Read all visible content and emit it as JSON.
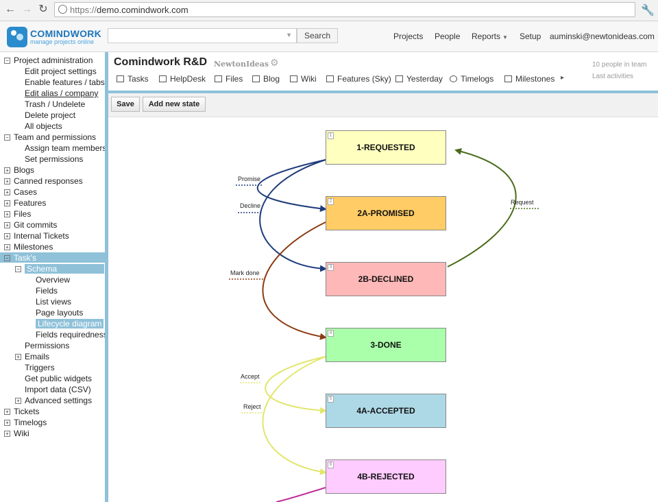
{
  "browser": {
    "url_prefix": "https://",
    "url_host": "demo.comindwork.com",
    "back_icon": "arrow-left-icon",
    "forward_icon": "arrow-right-icon",
    "reload_icon": "reload-icon",
    "wrench_icon": "wrench-icon"
  },
  "header": {
    "logo_name": "COMINDWORK",
    "logo_tagline": "manage projects online",
    "search_button": "Search",
    "nav": {
      "projects": "Projects",
      "people": "People",
      "reports": "Reports",
      "setup": "Setup",
      "user": "auminski@newtonideas.com"
    }
  },
  "sidebar": {
    "items": [
      {
        "label": "Project administration",
        "expander": "⊟"
      },
      {
        "label": "Edit project settings"
      },
      {
        "label": "Enable features / tabs"
      },
      {
        "label": "Edit alias / company"
      },
      {
        "label": "Trash / Undelete"
      },
      {
        "label": "Delete project"
      },
      {
        "label": "All objects"
      },
      {
        "label": "Team and permissions",
        "expander": "⊟"
      },
      {
        "label": "Assign team members"
      },
      {
        "label": "Set permissions"
      },
      {
        "label": "Blogs",
        "expander": "⊞"
      },
      {
        "label": "Canned responses",
        "expander": "⊞"
      },
      {
        "label": "Cases",
        "expander": "⊞"
      },
      {
        "label": "Features",
        "expander": "⊞"
      },
      {
        "label": "Files",
        "expander": "⊞"
      },
      {
        "label": "Git commits",
        "expander": "⊞"
      },
      {
        "label": "Internal Tickets",
        "expander": "⊞"
      },
      {
        "label": "Milestones",
        "expander": "⊞"
      },
      {
        "label": "Task's",
        "expander": "⊟"
      },
      {
        "label": "Schema",
        "expander": "⊟"
      },
      {
        "label": "Overview"
      },
      {
        "label": "Fields"
      },
      {
        "label": "List views"
      },
      {
        "label": "Page layouts"
      },
      {
        "label": "Lifecycle diagram"
      },
      {
        "label": "Fields requiredness"
      },
      {
        "label": "Permissions"
      },
      {
        "label": "Emails",
        "expander": "⊞"
      },
      {
        "label": "Triggers"
      },
      {
        "label": "Get public widgets"
      },
      {
        "label": "Import data (CSV)"
      },
      {
        "label": "Advanced settings",
        "expander": "⊞"
      },
      {
        "label": "Tickets",
        "expander": "⊞"
      },
      {
        "label": "Timelogs",
        "expander": "⊞"
      },
      {
        "label": "Wiki",
        "expander": "⊞"
      }
    ]
  },
  "project": {
    "title": "Comindwork R&D",
    "org": "NewtonIdeas",
    "people_info": "10 people in team",
    "last_activities": "Last activities"
  },
  "tabs": [
    {
      "label": "Tasks"
    },
    {
      "label": "HelpDesk"
    },
    {
      "label": "Files"
    },
    {
      "label": "Blog"
    },
    {
      "label": "Wiki"
    },
    {
      "label": "Features (Sky)"
    },
    {
      "label": "Yesterday"
    },
    {
      "label": "Timelogs"
    },
    {
      "label": "Milestones"
    }
  ],
  "toolbar": {
    "save": "Save",
    "add_state": "Add new state"
  },
  "diagram": {
    "states": [
      {
        "num": "1",
        "label": "1-REQUESTED",
        "color": "#ffffc0"
      },
      {
        "num": "2",
        "label": "2A-PROMISED",
        "color": "#ffcc66"
      },
      {
        "num": "3",
        "label": "2B-DECLINED",
        "color": "#ffb8b8"
      },
      {
        "num": "4",
        "label": "3-DONE",
        "color": "#aaffaa"
      },
      {
        "num": "5",
        "label": "4A-ACCEPTED",
        "color": "#add8e6"
      },
      {
        "num": "6",
        "label": "4B-REJECTED",
        "color": "#ffccff"
      }
    ],
    "transitions": [
      {
        "label": "Promise",
        "color": "#1f3c7a"
      },
      {
        "label": "Decline",
        "color": "#1f3c7a"
      },
      {
        "label": "Request",
        "color": "#4a6b1a"
      },
      {
        "label": "Mark done",
        "color": "#8b3a10"
      },
      {
        "label": "Accept",
        "color": "#e2e66b"
      },
      {
        "label": "Reject",
        "color": "#e2e66b"
      },
      {
        "label": "",
        "color": "#c0309a"
      }
    ]
  }
}
